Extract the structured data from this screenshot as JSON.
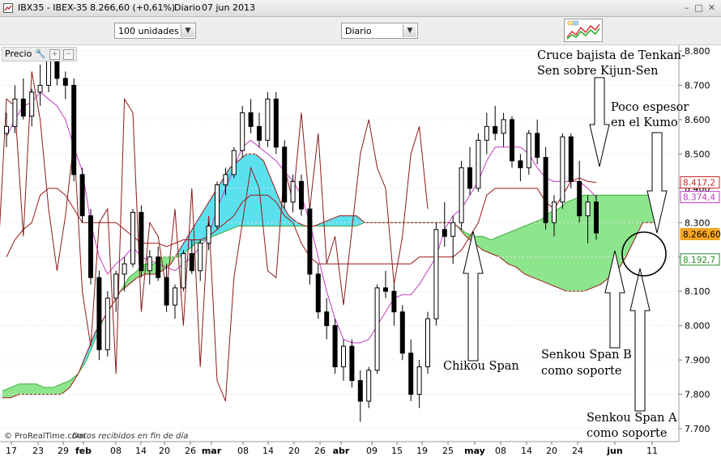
{
  "window": {
    "symbol": "IBX35 - IBEX-35",
    "price_change": "8.266,60 (+0,61%)",
    "period": "Diario",
    "date": "07 jun 2013",
    "buttons": [
      "minimize-icon",
      "maximize-icon",
      "close-icon"
    ]
  },
  "toolbar": {
    "units_select": "100 unidades",
    "period_select": "Diario",
    "indicator_icon": "chart-indicators-icon"
  },
  "panel": {
    "label": "Precio",
    "icons": [
      "wrench-icon",
      "add-icon",
      "remove-icon"
    ],
    "footer_brand": "© ProRealTime.com",
    "footer_note": "Datos recibidos en fin de día"
  },
  "chart_data": {
    "type": "candlestick",
    "title": "",
    "y_axis": {
      "range": [
        7650,
        8850
      ],
      "ticks": [
        "8.800",
        "8.700",
        "8.600",
        "8.500",
        "8.400",
        "8.300",
        "8.200",
        "8.100",
        "8.000",
        "7.900",
        "7.800",
        "7.700"
      ],
      "values": [
        8800,
        8700,
        8600,
        8500,
        8400,
        8300,
        8200,
        8100,
        8000,
        7900,
        7800,
        7700
      ]
    },
    "x_axis": {
      "labels": [
        "17",
        "23",
        "29",
        "feb",
        "08",
        "14",
        "20",
        "26",
        "mar",
        "08",
        "14",
        "20",
        "26",
        "abr",
        "09",
        "15",
        "19",
        "25",
        "may",
        "08",
        "14",
        "20",
        "24",
        "jun",
        "11"
      ],
      "bold": [
        "feb",
        "mar",
        "abr",
        "may",
        "jun"
      ]
    },
    "badges": [
      {
        "value": "8.417,2",
        "number": 8417.2,
        "color": "#c62828"
      },
      {
        "value": "8.374,4",
        "number": 8374.4,
        "color": "#c03cc0"
      },
      {
        "value": "8.266,60",
        "number": 8266.6,
        "color": "#f0a020"
      },
      {
        "value": "8.192,7",
        "number": 8192.7,
        "color": "#2e8b2e"
      }
    ],
    "colors": {
      "kumo_bullish": "#8de58d",
      "kumo_bearish": "#5be0ee",
      "tenkan": "#c03cc0",
      "kijun": "#a01818",
      "chikou": "#8b1a1a",
      "senkou_a": "#3fae3f",
      "senkou_b": "#a01818"
    },
    "annotations": [
      {
        "text": [
          "Cruce bajista de Tenkan-",
          "Sen sobre Kijun-Sen"
        ]
      },
      {
        "text": [
          "Poco espesor",
          "en el Kumo"
        ]
      },
      {
        "text": [
          "Chikou Span"
        ]
      },
      {
        "text": [
          "Senkou Span B",
          "como soporte"
        ]
      },
      {
        "text": [
          "Senkou Span A",
          "como soporte"
        ]
      }
    ],
    "candles_ohlc": [
      [
        8560,
        8620,
        8520,
        8580
      ],
      [
        8580,
        8700,
        8560,
        8660
      ],
      [
        8660,
        8720,
        8600,
        8610
      ],
      [
        8610,
        8690,
        8580,
        8680
      ],
      [
        8680,
        8760,
        8640,
        8700
      ],
      [
        8700,
        8800,
        8680,
        8780
      ],
      [
        8780,
        8810,
        8700,
        8720
      ],
      [
        8720,
        8740,
        8660,
        8700
      ],
      [
        8700,
        8720,
        8420,
        8440
      ],
      [
        8440,
        8460,
        8300,
        8320
      ],
      [
        8320,
        8340,
        8120,
        8140
      ],
      [
        8140,
        8160,
        7900,
        7930
      ],
      [
        7930,
        8100,
        7910,
        8080
      ],
      [
        8080,
        8160,
        8040,
        8150
      ],
      [
        8150,
        8200,
        8100,
        8180
      ],
      [
        8180,
        8340,
        8170,
        8330
      ],
      [
        8330,
        8350,
        8140,
        8160
      ],
      [
        8160,
        8220,
        8120,
        8200
      ],
      [
        8200,
        8230,
        8130,
        8140
      ],
      [
        8140,
        8180,
        8040,
        8060
      ],
      [
        8060,
        8120,
        8020,
        8110
      ],
      [
        8110,
        8220,
        8100,
        8210
      ],
      [
        8210,
        8250,
        8150,
        8160
      ],
      [
        8160,
        8250,
        8130,
        8240
      ],
      [
        8240,
        8300,
        8220,
        8290
      ],
      [
        8290,
        8420,
        8280,
        8410
      ],
      [
        8410,
        8460,
        8380,
        8440
      ],
      [
        8440,
        8520,
        8430,
        8510
      ],
      [
        8510,
        8640,
        8490,
        8620
      ],
      [
        8620,
        8660,
        8560,
        8580
      ],
      [
        8580,
        8620,
        8520,
        8540
      ],
      [
        8540,
        8680,
        8520,
        8660
      ],
      [
        8660,
        8680,
        8500,
        8520
      ],
      [
        8520,
        8540,
        8340,
        8360
      ],
      [
        8360,
        8440,
        8330,
        8420
      ],
      [
        8420,
        8440,
        8320,
        8340
      ],
      [
        8340,
        8350,
        8120,
        8150
      ],
      [
        8150,
        8180,
        8020,
        8040
      ],
      [
        8040,
        8080,
        7960,
        8000
      ],
      [
        8000,
        8020,
        7860,
        7880
      ],
      [
        7880,
        7960,
        7840,
        7940
      ],
      [
        7940,
        7960,
        7820,
        7840
      ],
      [
        7840,
        7870,
        7720,
        7780
      ],
      [
        7780,
        7880,
        7760,
        7870
      ],
      [
        7870,
        8120,
        7860,
        8110
      ],
      [
        8110,
        8160,
        8080,
        8100
      ],
      [
        8100,
        8120,
        8000,
        8040
      ],
      [
        8040,
        8060,
        7900,
        7920
      ],
      [
        7920,
        7960,
        7780,
        7800
      ],
      [
        7800,
        7900,
        7760,
        7880
      ],
      [
        7880,
        8040,
        7860,
        8020
      ],
      [
        8020,
        8300,
        8000,
        8280
      ],
      [
        8280,
        8360,
        8230,
        8260
      ],
      [
        8260,
        8320,
        8180,
        8300
      ],
      [
        8300,
        8480,
        8280,
        8460
      ],
      [
        8460,
        8520,
        8380,
        8400
      ],
      [
        8400,
        8560,
        8390,
        8540
      ],
      [
        8540,
        8620,
        8500,
        8580
      ],
      [
        8580,
        8640,
        8540,
        8560
      ],
      [
        8560,
        8620,
        8520,
        8600
      ],
      [
        8600,
        8610,
        8460,
        8480
      ],
      [
        8480,
        8500,
        8420,
        8460
      ],
      [
        8460,
        8570,
        8440,
        8560
      ],
      [
        8560,
        8600,
        8470,
        8490
      ],
      [
        8490,
        8520,
        8280,
        8300
      ],
      [
        8300,
        8380,
        8260,
        8360
      ],
      [
        8360,
        8560,
        8340,
        8550
      ],
      [
        8550,
        8560,
        8400,
        8420
      ],
      [
        8420,
        8480,
        8300,
        8320
      ],
      [
        8320,
        8380,
        8240,
        8360
      ],
      [
        8360,
        8380,
        8250,
        8270
      ]
    ],
    "tenkan_sen": [
      8550,
      8600,
      8640,
      8650,
      8680,
      8660,
      8640,
      8600,
      8520,
      8450,
      8300,
      8200,
      8150,
      8180,
      8200,
      8230,
      8200,
      8190,
      8180,
      8170,
      8160,
      8180,
      8200,
      8230,
      8260,
      8340,
      8400,
      8460,
      8520,
      8540,
      8520,
      8500,
      8480,
      8450,
      8420,
      8380,
      8300,
      8200,
      8100,
      8020,
      7960,
      7950,
      7950,
      7960,
      8000,
      8040,
      8080,
      8090,
      8090,
      8120,
      8160,
      8200,
      8280,
      8320,
      8340,
      8380,
      8420,
      8480,
      8520,
      8520,
      8520,
      8520,
      8500,
      8460,
      8430,
      8420,
      8420,
      8420,
      8420,
      8400,
      8374
    ],
    "kijun_sen": [
      8200,
      8250,
      8280,
      8300,
      8380,
      8400,
      8400,
      8380,
      8340,
      8300,
      8300,
      8300,
      8300,
      8300,
      8280,
      8260,
      8240,
      8240,
      8240,
      8230,
      8240,
      8250,
      8250,
      8250,
      8260,
      8280,
      8300,
      8320,
      8360,
      8380,
      8380,
      8380,
      8360,
      8320,
      8300,
      8240,
      8200,
      8180,
      8180,
      8180,
      8180,
      8180,
      8180,
      8180,
      8180,
      8180,
      8180,
      8180,
      8180,
      8200,
      8200,
      8200,
      8200,
      8200,
      8220,
      8260,
      8300,
      8380,
      8400,
      8400,
      8400,
      8400,
      8400,
      8400,
      8360,
      8340,
      8380,
      8420,
      8430,
      8420,
      8417
    ],
    "chikou_span": [
      8200,
      8660,
      8640,
      8260,
      8740,
      8600,
      8340,
      8160,
      8320,
      8540,
      8100,
      7940,
      8300,
      8340,
      7860,
      8660,
      8620,
      8040,
      8300,
      8260,
      8100,
      8340,
      8000,
      8400,
      7880,
      8320,
      7840,
      7780,
      8140,
      8300,
      8460,
      8400,
      8160,
      8140,
      8460,
      8360,
      8620,
      8340,
      8560,
      8180,
      8260,
      8060,
      8280,
      8500,
      8600,
      8460,
      8400,
      8120,
      8260,
      8500,
      8580,
      8340
    ]
  }
}
